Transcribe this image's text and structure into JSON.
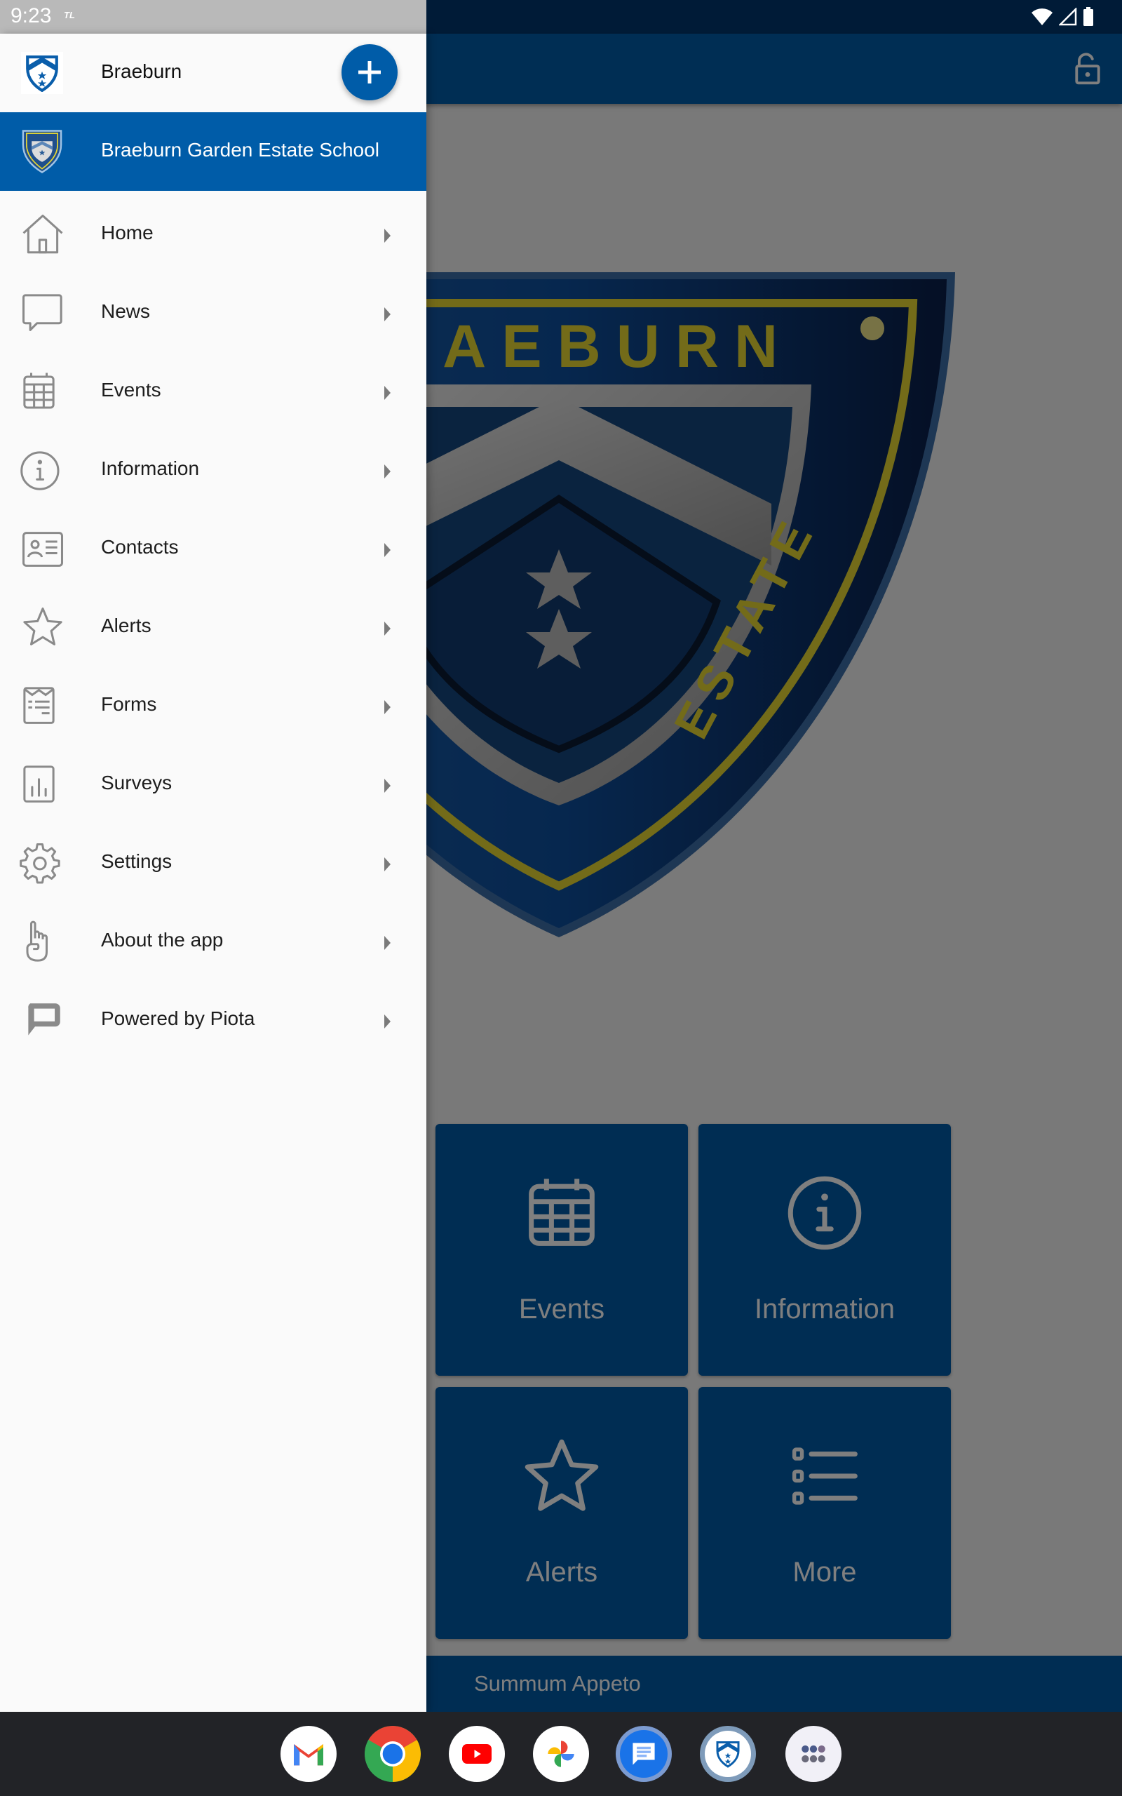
{
  "status_bar": {
    "time": "9:23",
    "carrier_badge": "TL",
    "icons": [
      "wifi-icon",
      "cell-signal-icon",
      "battery-icon"
    ]
  },
  "app_background": {
    "toolbar_icons": [
      "lock-open-icon"
    ],
    "crest": {
      "top_text": "BRAEBURN",
      "side_text": "ESTATE"
    },
    "tiles": [
      {
        "label": "Events",
        "icon": "calendar-icon"
      },
      {
        "label": "Information",
        "icon": "info-icon"
      },
      {
        "label": "Alerts",
        "icon": "star-icon"
      },
      {
        "label": "More",
        "icon": "list-icon"
      }
    ],
    "footer_text": "Summum Appeto",
    "colors": {
      "primary": "#005ca8",
      "scrim": "rgba(0,0,0,0.5)",
      "gold": "#e6d632"
    }
  },
  "drawer": {
    "header": {
      "title": "Braeburn",
      "add_button_icon": "plus-icon"
    },
    "selected_school": "Braeburn Garden Estate School",
    "menu": [
      {
        "label": "Home",
        "icon": "home-icon"
      },
      {
        "label": "News",
        "icon": "chat-bubble-icon"
      },
      {
        "label": "Events",
        "icon": "calendar-icon"
      },
      {
        "label": "Information",
        "icon": "info-icon"
      },
      {
        "label": "Contacts",
        "icon": "contact-card-icon"
      },
      {
        "label": "Alerts",
        "icon": "star-icon"
      },
      {
        "label": "Forms",
        "icon": "form-icon"
      },
      {
        "label": "Surveys",
        "icon": "bar-chart-icon"
      },
      {
        "label": "Settings",
        "icon": "gear-icon"
      },
      {
        "label": "About the app",
        "icon": "hand-pointer-icon"
      },
      {
        "label": "Powered by Piota",
        "icon": "piota-logo-icon"
      }
    ]
  },
  "dock": {
    "apps": [
      "Gmail",
      "Chrome",
      "YouTube",
      "Photos",
      "Messages",
      "Braeburn",
      "App drawer"
    ]
  }
}
